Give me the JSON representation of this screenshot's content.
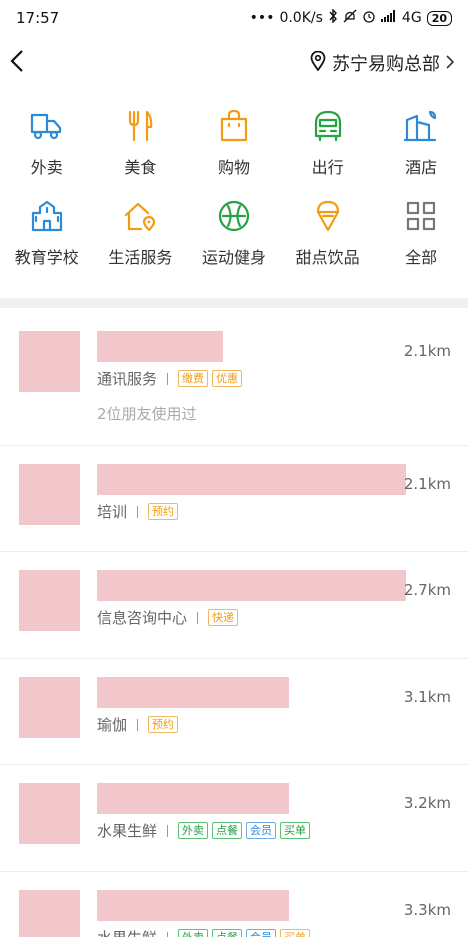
{
  "status": {
    "time": "17:57",
    "dots": "•••",
    "speed": "0.0K/s",
    "network": "4G",
    "battery": "20"
  },
  "nav": {
    "location": "苏宁易购总部"
  },
  "categories": [
    {
      "label": "外卖",
      "icon": "delivery-icon",
      "color": "#2d8ad9"
    },
    {
      "label": "美食",
      "icon": "fork-knife-icon",
      "color": "#f39c12"
    },
    {
      "label": "购物",
      "icon": "shopping-bag-icon",
      "color": "#f39c12"
    },
    {
      "label": "出行",
      "icon": "bus-icon",
      "color": "#25a244"
    },
    {
      "label": "酒店",
      "icon": "hotel-icon",
      "color": "#2d8ad9"
    },
    {
      "label": "教育学校",
      "icon": "school-icon",
      "color": "#2d8ad9"
    },
    {
      "label": "生活服务",
      "icon": "home-service-icon",
      "color": "#f39c12"
    },
    {
      "label": "运动健身",
      "icon": "sport-icon",
      "color": "#25a244"
    },
    {
      "label": "甜点饮品",
      "icon": "ice-cream-icon",
      "color": "#f39c12"
    },
    {
      "label": "全部",
      "icon": "grid-icon",
      "color": "#777777"
    }
  ],
  "places": [
    {
      "category": "通讯服务",
      "distance": "2.1km",
      "tags": [
        {
          "text": "缴费",
          "color": "orange"
        },
        {
          "text": "优惠",
          "color": "orange"
        }
      ],
      "friends": "2位朋友使用过",
      "name_width": 0.27
    },
    {
      "category": "培训",
      "distance": "2.1km",
      "tags": [
        {
          "text": "预约",
          "color": "orange"
        }
      ],
      "friends": "",
      "name_width": 0.66
    },
    {
      "category": "信息咨询中心",
      "distance": "2.7km",
      "tags": [
        {
          "text": "快递",
          "color": "orange"
        }
      ],
      "friends": "",
      "name_width": 0.66
    },
    {
      "category": "瑜伽",
      "distance": "3.1km",
      "tags": [
        {
          "text": "预约",
          "color": "orange"
        }
      ],
      "friends": "",
      "name_width": 0.41
    },
    {
      "category": "水果生鲜",
      "distance": "3.2km",
      "tags": [
        {
          "text": "外卖",
          "color": "green"
        },
        {
          "text": "点餐",
          "color": "green"
        },
        {
          "text": "会员",
          "color": "blue"
        },
        {
          "text": "买单",
          "color": "green"
        }
      ],
      "friends": "",
      "name_width": 0.41
    },
    {
      "category": "水果生鲜",
      "distance": "3.3km",
      "tags": [
        {
          "text": "外卖",
          "color": "green"
        },
        {
          "text": "点餐",
          "color": "green"
        },
        {
          "text": "会员",
          "color": "blue"
        },
        {
          "text": "买单",
          "color": "orange"
        }
      ],
      "friends": "",
      "name_width": 0.41
    }
  ]
}
